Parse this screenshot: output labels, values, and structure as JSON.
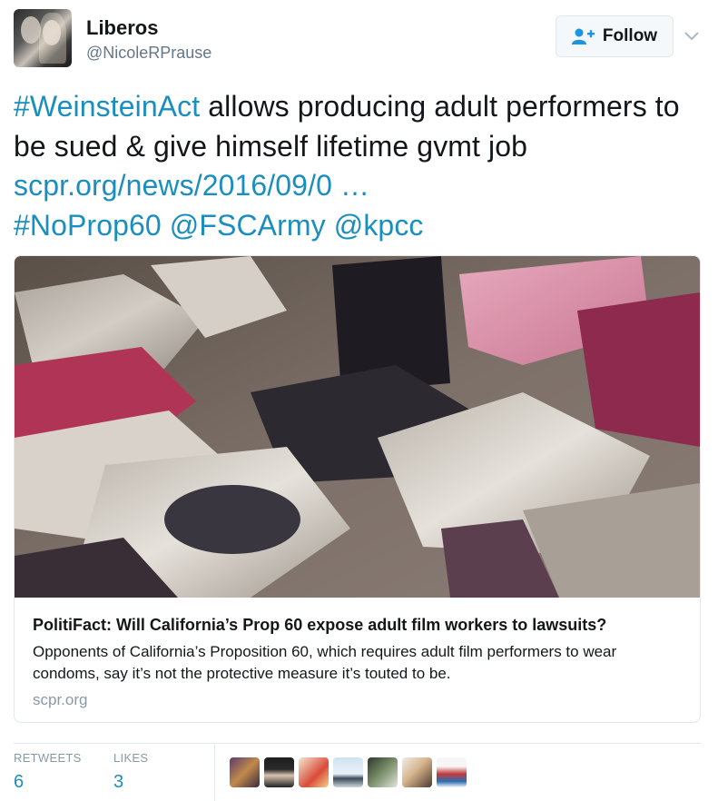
{
  "user": {
    "display_name": "Liberos",
    "handle": "@NicoleRPrause"
  },
  "follow": {
    "label": "Follow",
    "icon": "add-user-icon"
  },
  "menu": {
    "icon": "chevron-down-icon"
  },
  "tweet": {
    "hashtag1": "#WeinsteinAct",
    "text1": " allows producing adult performers to be sued & give himself lifetime gvmt job ",
    "url": "scpr.org/news/2016/09/0 …",
    "hashtag2": "#NoProp60",
    "mention1": "@FSCArmy",
    "mention2": "@kpcc"
  },
  "card": {
    "title": "PolitiFact: Will California’s Prop 60 expose adult film workers to lawsuits?",
    "description": "Opponents of California’s Proposition 60, which requires adult film performers to wear condoms, say it’s not the protective measure it’s touted to be.",
    "domain": "scpr.org"
  },
  "stats": {
    "retweets_label": "RETWEETS",
    "retweets_value": "6",
    "likes_label": "LIKES",
    "likes_value": "3"
  },
  "colors": {
    "link": "#1a8fbf",
    "muted": "#8899a6",
    "text": "#14171a",
    "border": "#e1e8ed"
  }
}
